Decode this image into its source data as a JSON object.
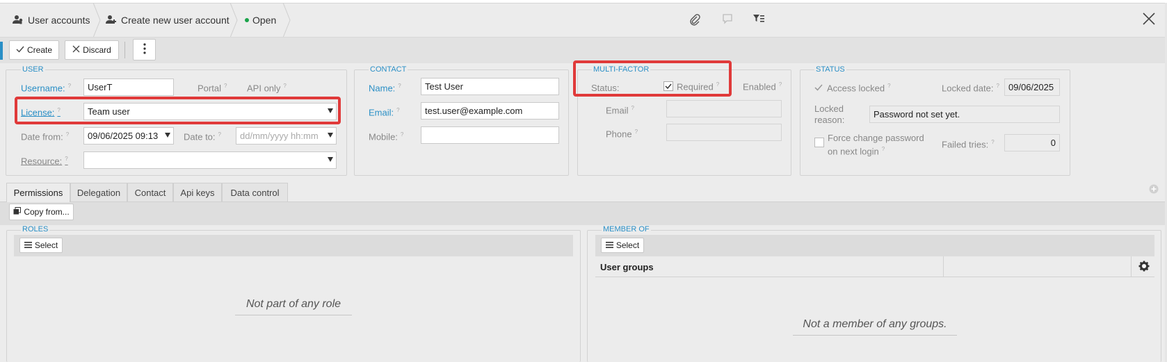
{
  "breadcrumb": {
    "item1": "User accounts",
    "item2": "Create new user account",
    "item3": "Open",
    "status_color": "#1aa34a"
  },
  "toolbar": {
    "create_label": "Create",
    "discard_label": "Discard"
  },
  "user_group": {
    "legend": "USER",
    "username_label": "Username:",
    "username_value": "UserT",
    "portal_label": "Portal",
    "api_only_label": "API only",
    "license_label": "License:",
    "license_value": "Team user",
    "date_from_label": "Date from:",
    "date_from_value": "09/06/2025 09:13",
    "date_to_label": "Date to:",
    "date_to_placeholder": "dd/mm/yyyy hh:mm",
    "resource_label": "Resource:",
    "resource_value": ""
  },
  "contact_group": {
    "legend": "CONTACT",
    "name_label": "Name:",
    "name_value": "Test User",
    "email_label": "Email:",
    "email_value": "test.user@example.com",
    "mobile_label": "Mobile:",
    "mobile_value": ""
  },
  "mfa_group": {
    "legend": "MULTI-FACTOR",
    "status_label": "Status:",
    "required_label": "Required",
    "required_checked": true,
    "enabled_label": "Enabled",
    "email_label": "Email",
    "phone_label": "Phone"
  },
  "status_group": {
    "legend": "STATUS",
    "access_locked_label": "Access locked",
    "locked_date_label": "Locked date:",
    "locked_date_value": "09/06/2025",
    "locked_reason_label": "Locked reason:",
    "locked_reason_line1": "Locked",
    "locked_reason_line2": "reason:",
    "locked_reason_value": "Password not set yet.",
    "force_change_line1": "Force change password",
    "force_change_line2": "on next login",
    "failed_tries_label": "Failed tries:",
    "failed_tries_value": "0"
  },
  "tabs": [
    "Permissions",
    "Delegation",
    "Contact",
    "Api keys",
    "Data control"
  ],
  "permissions": {
    "copy_from_label": "Copy from...",
    "roles": {
      "legend": "ROLES",
      "select_label": "Select",
      "empty_text": "Not part of any role"
    },
    "member_of": {
      "legend": "MEMBER OF",
      "select_label": "Select",
      "column_header": "User groups",
      "empty_text": "Not a member of any groups."
    }
  },
  "colors": {
    "accent": "#2a8fc6",
    "highlight": "#e03a3a"
  }
}
